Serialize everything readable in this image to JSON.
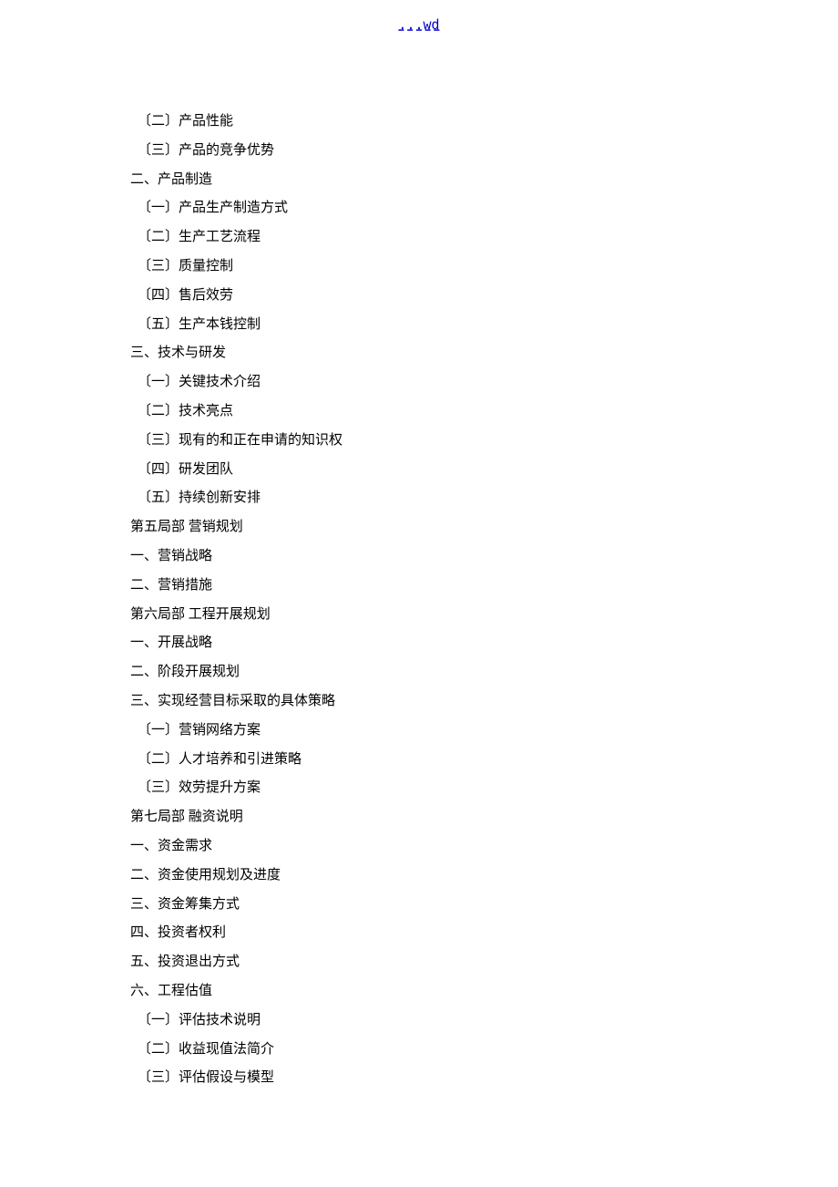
{
  "header": {
    "link_text": "...wd"
  },
  "lines": [
    "〔二〕产品性能",
    "〔三〕产品的竞争优势",
    "二、产品制造",
    "〔一〕产品生产制造方式",
    "〔二〕生产工艺流程",
    "〔三〕质量控制",
    "〔四〕售后效劳",
    "〔五〕生产本钱控制",
    "三、技术与研发",
    "〔一〕关键技术介绍",
    "〔二〕技术亮点",
    "〔三〕现有的和正在申请的知识权",
    "〔四〕研发团队",
    "〔五〕持续创新安排",
    "第五局部  营销规划",
    "一、营销战略",
    "二、营销措施",
    "第六局部  工程开展规划",
    "一、开展战略",
    "二、阶段开展规划",
    "三、实现经营目标采取的具体策略",
    "〔一〕营销网络方案",
    "〔二〕人才培养和引进策略",
    "〔三〕效劳提升方案",
    "第七局部  融资说明",
    "一、资金需求",
    "二、资金使用规划及进度",
    "三、资金筹集方式",
    "四、投资者权利",
    "五、投资退出方式",
    "六、工程估值",
    "〔一〕评估技术说明",
    "〔二〕收益现值法简介",
    "〔三〕评估假设与模型"
  ],
  "indent_flags": [
    true,
    true,
    false,
    true,
    true,
    true,
    true,
    true,
    false,
    true,
    true,
    true,
    true,
    true,
    false,
    false,
    false,
    false,
    false,
    false,
    false,
    true,
    true,
    true,
    false,
    false,
    false,
    false,
    false,
    false,
    false,
    true,
    true,
    true
  ]
}
